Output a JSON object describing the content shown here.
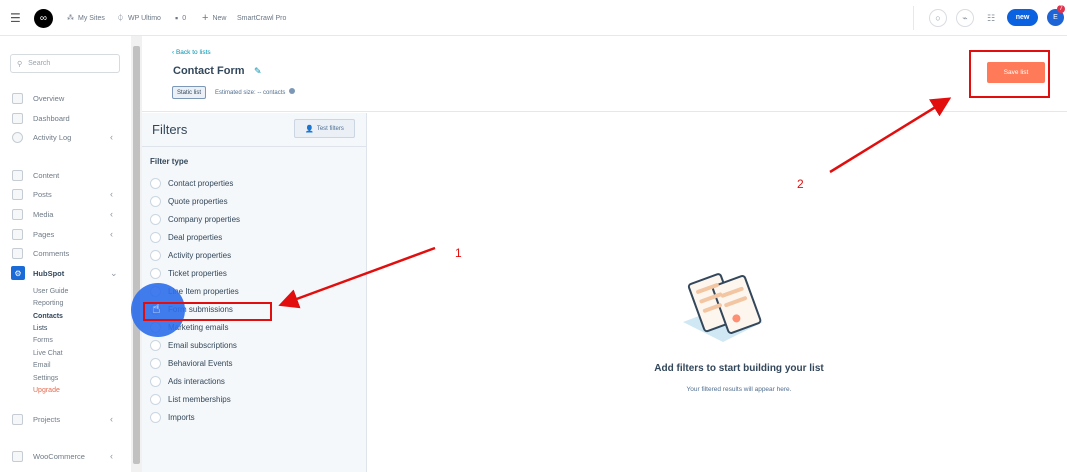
{
  "topbar": {
    "my_sites": "My Sites",
    "wp_ultimo": "WP Ultimo",
    "comments_count": "0",
    "new_label": "New",
    "site_name": "SmartCrawl Pro",
    "new_button": "new",
    "avatar_letter": "E",
    "notif_count": "7"
  },
  "sidebar": {
    "search_placeholder": "Search",
    "items": [
      {
        "label": "Overview"
      },
      {
        "label": "Dashboard"
      },
      {
        "label": "Activity Log"
      },
      {
        "label": "Content"
      },
      {
        "label": "Posts"
      },
      {
        "label": "Media"
      },
      {
        "label": "Pages"
      },
      {
        "label": "Comments"
      },
      {
        "label": "HubSpot"
      },
      {
        "label": "Projects"
      },
      {
        "label": "WooCommerce"
      }
    ],
    "hubspot_sub": [
      "User Guide",
      "Reporting",
      "Contacts",
      "Lists",
      "Forms",
      "Live Chat",
      "Email",
      "Settings",
      "Upgrade"
    ]
  },
  "header": {
    "back": "‹ Back to lists",
    "title": "Contact Form",
    "badge": "Static list",
    "estimated": "Estimated size: -- contacts",
    "save": "Save list"
  },
  "filters": {
    "title": "Filters",
    "test_button": "Test filters",
    "filter_type_label": "Filter type",
    "types": [
      "Contact properties",
      "Quote properties",
      "Company properties",
      "Deal properties",
      "Activity properties",
      "Ticket properties",
      "Line Item properties",
      "Form submissions",
      "Marketing emails",
      "Email subscriptions",
      "Behavioral Events",
      "Ads interactions",
      "List memberships",
      "Imports"
    ]
  },
  "empty_state": {
    "title": "Add filters to start building your list",
    "subtitle": "Your filtered results will appear here."
  },
  "annotations": {
    "step1": "1",
    "step2": "2",
    "color": "#e20e0e"
  },
  "colors": {
    "save_button": "#ff7a59",
    "new_button": "#0b62e0",
    "link": "#0091ae"
  }
}
